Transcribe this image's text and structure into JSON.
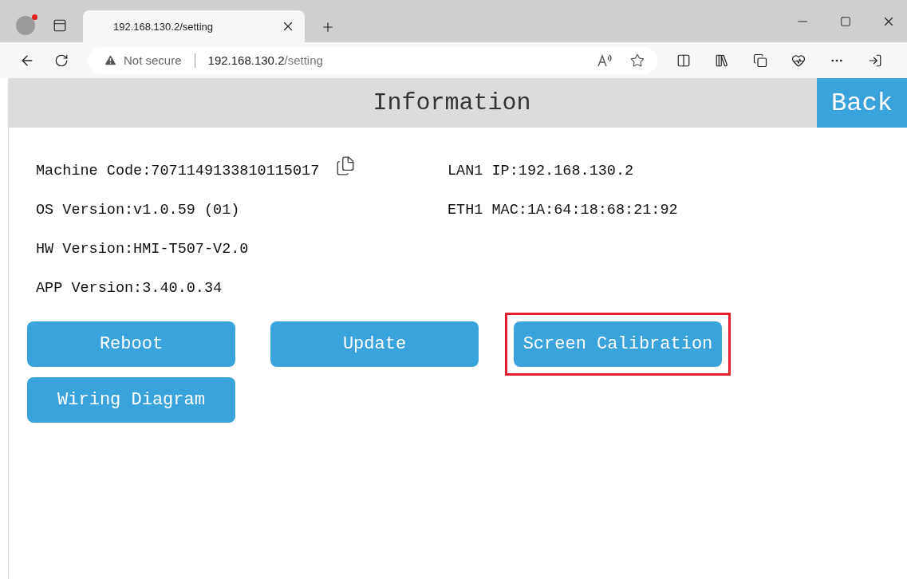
{
  "browser": {
    "tab_title": "192.168.130.2/setting",
    "security": "Not secure",
    "address_host": "192.168.130.2",
    "address_path": "/setting"
  },
  "header": {
    "title": "Information",
    "back": "Back"
  },
  "info_left": [
    {
      "text": "Machine Code:7071149133810115017",
      "kind": "copyable"
    },
    {
      "text": "OS Version:v1.0.59 (01)",
      "kind": "plain"
    },
    {
      "text": "HW Version:HMI-T507-V2.0",
      "kind": "plain"
    },
    {
      "text": "APP Version:3.40.0.34",
      "kind": "plain"
    }
  ],
  "info_right": [
    {
      "text": "LAN1 IP:192.168.130.2"
    },
    {
      "text": "ETH1 MAC:1A:64:18:68:21:92"
    }
  ],
  "buttons": [
    {
      "label": "Reboot",
      "highlighted": false
    },
    {
      "label": "Update",
      "highlighted": false
    },
    {
      "label": "Screen Calibration",
      "highlighted": true
    },
    {
      "label": "Wiring Diagram",
      "highlighted": false
    }
  ]
}
